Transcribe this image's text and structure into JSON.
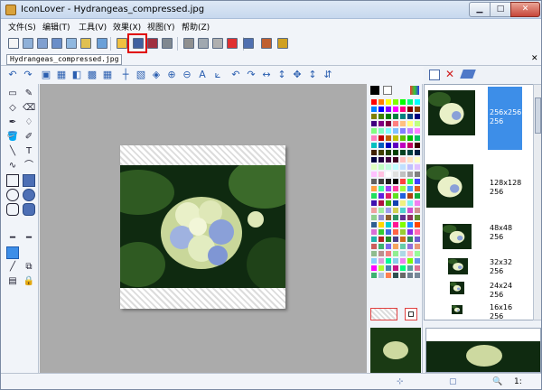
{
  "window": {
    "title": "IconLover - Hydrangeas_compressed.jpg",
    "minimize_glyph": "▁",
    "maximize_glyph": "□",
    "close_glyph": "✕"
  },
  "menu": [
    {
      "label": "文件(S)"
    },
    {
      "label": "编辑(T)"
    },
    {
      "label": "工具(V)"
    },
    {
      "label": "效果(X)"
    },
    {
      "label": "视图(Y)"
    },
    {
      "label": "帮助(Z)"
    }
  ],
  "toolbar": {
    "buttons": [
      {
        "icon": "new-icon",
        "color": "#f5f5f5"
      },
      {
        "icon": "new-image-icon",
        "color": "#8fb0d8"
      },
      {
        "icon": "new-library-icon",
        "color": "#7f9fd0"
      },
      {
        "icon": "new-cursor-icon",
        "color": "#6a8ec8"
      },
      {
        "icon": "new-animated-icon",
        "color": "#90b8e0"
      },
      {
        "icon": "new-toolbar-icon",
        "color": "#e0c050"
      },
      {
        "icon": "new-favicon-icon",
        "color": "#6aa0d8"
      },
      {
        "icon": "open-icon",
        "color": "#f0c040"
      },
      {
        "icon": "save-icon",
        "color": "#4060a0"
      },
      {
        "icon": "save-as-icon",
        "color": "#a03040"
      },
      {
        "icon": "print-icon",
        "color": "#808890"
      },
      {
        "icon": "cut-icon",
        "color": "#909090"
      },
      {
        "icon": "copy-icon",
        "color": "#a0a8b0"
      },
      {
        "icon": "paste-icon",
        "color": "#b0b0b0"
      },
      {
        "icon": "delete-icon",
        "color": "#e03030"
      },
      {
        "icon": "properties-icon",
        "color": "#5070b0"
      },
      {
        "icon": "resources-icon",
        "color": "#c06030"
      },
      {
        "icon": "help-book-icon",
        "color": "#d0a020"
      }
    ]
  },
  "document_tab": {
    "label": "Hydrangeas_compressed.jpg",
    "close_glyph": "✕"
  },
  "edit_toolbar": {
    "glyphs": [
      "↶",
      "↷",
      "▣",
      "▦",
      "◧",
      "▩",
      "▦",
      "┼",
      "▧",
      "◈",
      "⊕",
      "⊖",
      "A",
      "⟀",
      "↶",
      "↷",
      "↔",
      "↕",
      "✥",
      "↕",
      "⇵"
    ]
  },
  "tools": {
    "glyphs": [
      "▭",
      "✎",
      "◇",
      "⌫",
      "✒",
      "♢",
      "🪣",
      "✐",
      "╲",
      "T",
      "∿",
      "⌒",
      "",
      "",
      "",
      "",
      "",
      "",
      "",
      "",
      "━",
      "━",
      "",
      "",
      "╱",
      "⧉",
      "▤",
      "🔒"
    ]
  },
  "palette": {
    "colors": [
      "#ff0000",
      "#ff8000",
      "#ffff00",
      "#80ff00",
      "#00ff00",
      "#00ff80",
      "#00ffff",
      "#0080ff",
      "#0000ff",
      "#8000ff",
      "#ff00ff",
      "#ff0080",
      "#800000",
      "#804000",
      "#808000",
      "#408000",
      "#008000",
      "#008040",
      "#008080",
      "#004080",
      "#000080",
      "#400080",
      "#800080",
      "#800040",
      "#ff8080",
      "#ffc080",
      "#ffff80",
      "#c0ff80",
      "#80ff80",
      "#80ffc0",
      "#80ffff",
      "#80c0ff",
      "#8080ff",
      "#c080ff",
      "#ff80ff",
      "#ff80c0",
      "#c00000",
      "#c06000",
      "#c0c000",
      "#60c000",
      "#00c000",
      "#00c060",
      "#00c0c0",
      "#0060c0",
      "#0000c0",
      "#6000c0",
      "#c000c0",
      "#c00060",
      "#400000",
      "#402000",
      "#404000",
      "#204000",
      "#004000",
      "#004020",
      "#004040",
      "#002040",
      "#000040",
      "#200040",
      "#400040",
      "#400020",
      "#ffc0c0",
      "#ffe0c0",
      "#ffffc0",
      "#e0ffc0",
      "#c0ffc0",
      "#c0ffe0",
      "#c0ffff",
      "#c0e0ff",
      "#c0c0ff",
      "#e0c0ff",
      "#ffc0ff",
      "#ffc0e0",
      "#ffffff",
      "#e0e0e0",
      "#c0c0c0",
      "#a0a0a0",
      "#808080",
      "#606060",
      "#404040",
      "#202020",
      "#000000",
      "#ff4040",
      "#40ff40",
      "#4040ff",
      "#ffa040",
      "#40ffa0",
      "#a040ff",
      "#ff40a0",
      "#a0ff40",
      "#40a0ff",
      "#e06020",
      "#20e060",
      "#6020e0",
      "#e02060",
      "#60e020",
      "#2060e0",
      "#b04010",
      "#10b040",
      "#4010b0",
      "#b01040",
      "#40b010",
      "#1040b0",
      "#f0f080",
      "#80f0f0",
      "#f080f0",
      "#f0a0a0",
      "#a0f0a0",
      "#a0a0f0",
      "#d0d050",
      "#50d0d0",
      "#d050d0",
      "#d09090",
      "#90d090",
      "#9090d0",
      "#906030",
      "#309060",
      "#603090",
      "#903060",
      "#609030",
      "#306090",
      "#ffd700",
      "#00ced1",
      "#ff1493",
      "#7fff00",
      "#1e90ff",
      "#ff4500",
      "#da70d6",
      "#32cd32",
      "#4169e1",
      "#ff6347",
      "#9acd32",
      "#8a2be2",
      "#ff69b4",
      "#20b2aa",
      "#b22222",
      "#228b22",
      "#483d8b",
      "#d2691e",
      "#2e8b57",
      "#6a5acd",
      "#cd5c5c",
      "#3cb371",
      "#7b68ee",
      "#f4a460",
      "#66cdaa",
      "#9370db",
      "#e9967a",
      "#8fbc8f",
      "#bc8f8f",
      "#f08080",
      "#90ee90",
      "#add8e6",
      "#ffb6c1",
      "#98fb98",
      "#87cefa",
      "#dda0dd",
      "#00fa9a",
      "#87ceeb",
      "#ee82ee",
      "#7cfc00",
      "#6495ed",
      "#ff00ff",
      "#adff2f",
      "#4682b4",
      "#c71585",
      "#00ff7f",
      "#5f9ea0",
      "#db7093",
      "#3cb371",
      "#b0c4de",
      "#ff7f50",
      "#2f4f4f",
      "#696969",
      "#708090",
      "#778899"
    ]
  },
  "icon_list": [
    {
      "size": "256x256",
      "depth": "256"
    },
    {
      "size": "128x128",
      "depth": "256"
    },
    {
      "size": "48x48",
      "depth": "256"
    },
    {
      "size": "32x32",
      "depth": "256"
    },
    {
      "size": "24x24",
      "depth": "256"
    },
    {
      "size": "16x16",
      "depth": "256"
    }
  ],
  "status": {
    "zoom_level": "1:"
  },
  "colors": {
    "selection": "#3d8ee8",
    "canvas_bg": "#ababab",
    "leaf_dark": "#0f2a10",
    "leaf_mid": "#2f5a22",
    "flower_white": "#e9f0c8",
    "flower_blue": "#8aa0d8"
  }
}
